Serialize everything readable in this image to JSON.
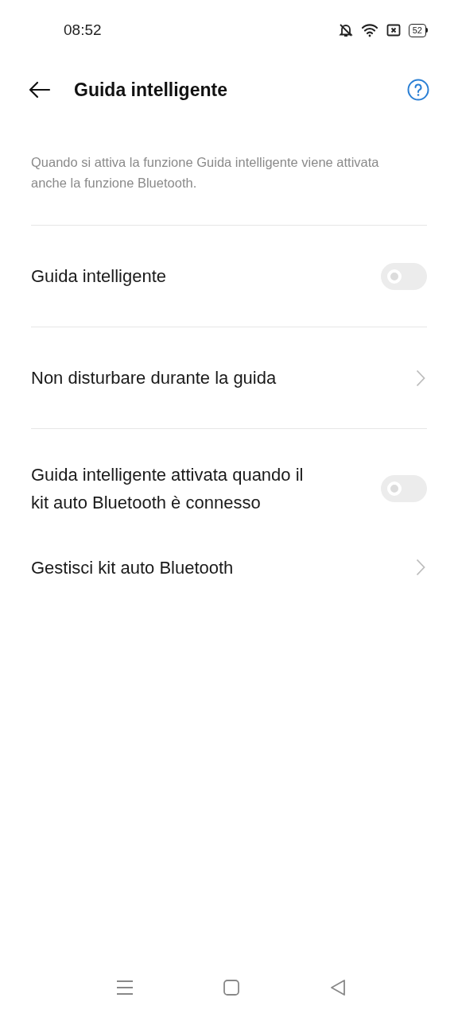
{
  "status_bar": {
    "time": "08:52",
    "battery": "52"
  },
  "header": {
    "title": "Guida intelligente"
  },
  "description": "Quando si attiva la funzione Guida intelligente viene attivata anche la funzione Bluetooth.",
  "items": [
    {
      "kind": "toggle",
      "label": "Guida intelligente",
      "on": false,
      "divider_after": true
    },
    {
      "kind": "link",
      "label": "Non disturbare durante la guida",
      "divider_after": true
    },
    {
      "kind": "toggle",
      "label": "Guida intelligente attivata quando il kit auto Bluetooth è connesso",
      "on": false,
      "divider_after": false
    },
    {
      "kind": "link",
      "label": "Gestisci kit auto Bluetooth",
      "divider_after": false
    }
  ]
}
